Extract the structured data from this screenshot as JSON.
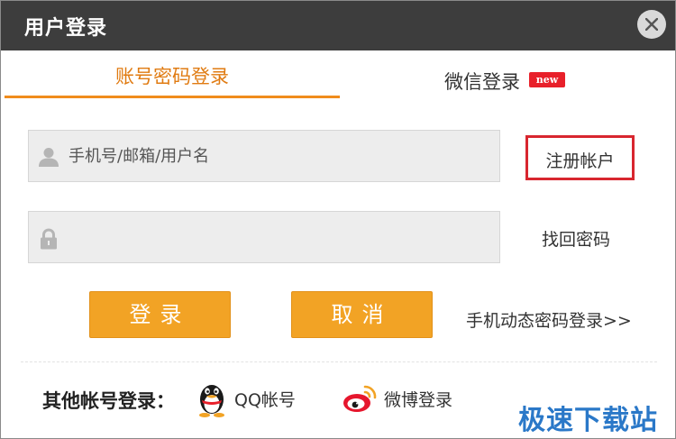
{
  "window": {
    "title": "用户登录"
  },
  "tabs": {
    "account": {
      "label": "账号密码登录"
    },
    "wechat": {
      "label": "微信登录",
      "badge": "new"
    }
  },
  "form": {
    "username_placeholder": "手机号/邮箱/用户名",
    "password_placeholder": "",
    "register_link": "注册帐户",
    "forgot_link": "找回密码",
    "login_button": "登录",
    "cancel_button": "取消",
    "phone_login_link": "手机动态密码登录>>"
  },
  "other_login": {
    "label": "其他帐号登录：",
    "qq": "QQ帐号",
    "weibo": "微博登录"
  },
  "watermark": "极速下载站",
  "colors": {
    "titlebar": "#3d3d3d",
    "accent_orange": "#f08c1c",
    "button_orange": "#f2a325",
    "badge_red": "#e8202a",
    "highlight_red": "#d8262f",
    "watermark_blue": "#2a78c8"
  }
}
